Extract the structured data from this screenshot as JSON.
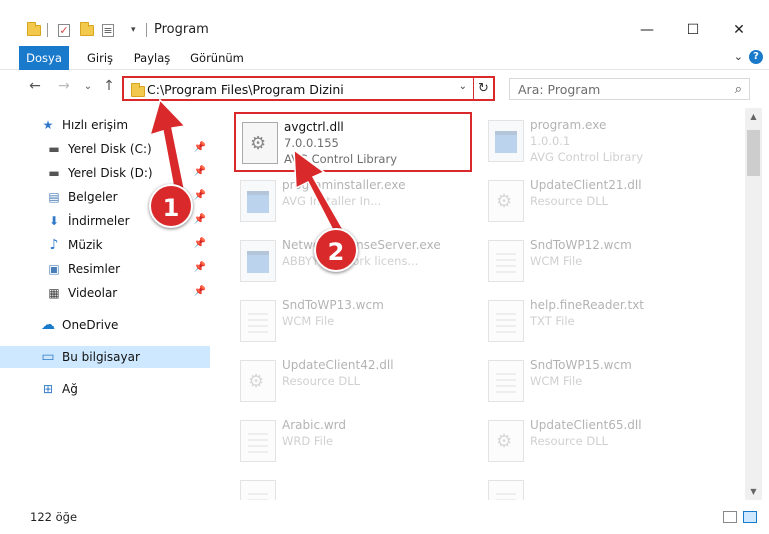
{
  "window": {
    "title": "Program",
    "minimize": "—",
    "maximize": "☐",
    "close": "✕"
  },
  "ribbon": {
    "tabs": [
      {
        "label": "Dosya"
      },
      {
        "label": "Giriş"
      },
      {
        "label": "Paylaş"
      },
      {
        "label": "Görünüm"
      }
    ],
    "expand": "⌄",
    "help": "?"
  },
  "nav": {
    "back": "←",
    "forward": "→",
    "recent": "⌄",
    "up": "↑",
    "address": "C:\\Program Files\\Program Dizini",
    "address_dropdown": "⌄",
    "refresh": "↻",
    "search_placeholder": "Ara: Program",
    "search_icon": "⌕"
  },
  "sidebar": {
    "items": [
      {
        "label": "Hızlı erişim",
        "icon": "star-icon",
        "glyph": "★",
        "color": "#2f79c8"
      },
      {
        "label": "Yerel Disk (C:)",
        "icon": "drive-icon",
        "glyph": "▬",
        "color": "#555555",
        "pin": "📌"
      },
      {
        "label": "Yerel Disk (D:)",
        "icon": "drive-icon",
        "glyph": "▬",
        "color": "#555555",
        "pin": "📌"
      },
      {
        "label": "Belgeler",
        "icon": "documents-icon",
        "glyph": "▤",
        "color": "#4a7ebb",
        "pin": "📌"
      },
      {
        "label": "İndirmeler",
        "icon": "download-icon",
        "glyph": "⬇",
        "color": "#2f79c8",
        "pin": "📌"
      },
      {
        "label": "Müzik",
        "icon": "music-icon",
        "glyph": "♪",
        "color": "#2f79c8",
        "pin": "📌"
      },
      {
        "label": "Resimler",
        "icon": "pictures-icon",
        "glyph": "▣",
        "color": "#4a7ebb",
        "pin": "📌"
      },
      {
        "label": "Videolar",
        "icon": "videos-icon",
        "glyph": "▦",
        "color": "#444444",
        "pin": "📌"
      },
      {
        "label": "OneDrive",
        "icon": "cloud-icon",
        "glyph": "☁",
        "color": "#1979ca"
      },
      {
        "label": "Bu bilgisayar",
        "icon": "computer-icon",
        "glyph": "▭",
        "color": "#2f79c8"
      },
      {
        "label": "Ağ",
        "icon": "network-icon",
        "glyph": "⊞",
        "color": "#2f79c8"
      }
    ]
  },
  "files": [
    {
      "name": "avgctrl.dll",
      "version": "7.0.0.155",
      "desc": "AVG Control Library",
      "type": "dll"
    },
    {
      "name": "program.exe",
      "version": "1.0.0.1",
      "desc": "AVG Control Library",
      "type": "exe"
    },
    {
      "name": "programinstaller.exe",
      "version": "",
      "desc": "AVG Installer In...",
      "type": "exe"
    },
    {
      "name": "UpdateClient21.dll",
      "version": "",
      "desc": "Resource DLL",
      "type": "dll"
    },
    {
      "name": "NetworkLicenseServer.exe",
      "version": "",
      "desc": "ABBYY Network licens...",
      "type": "exe"
    },
    {
      "name": "SndToWP12.wcm",
      "version": "",
      "desc": "WCM File",
      "type": "doc"
    },
    {
      "name": "SndToWP13.wcm",
      "version": "",
      "desc": "WCM File",
      "type": "doc"
    },
    {
      "name": "help.fineReader.txt",
      "version": "",
      "desc": "TXT File",
      "type": "doc"
    },
    {
      "name": "UpdateClient42.dll",
      "version": "",
      "desc": "Resource DLL",
      "type": "dll"
    },
    {
      "name": "SndToWP15.wcm",
      "version": "",
      "desc": "WCM File",
      "type": "doc"
    },
    {
      "name": "Arabic.wrd",
      "version": "",
      "desc": "WRD File",
      "type": "doc"
    },
    {
      "name": "UpdateClient65.dll",
      "version": "",
      "desc": "Resource DLL",
      "type": "dll"
    }
  ],
  "status": {
    "count": "122 öğe"
  },
  "annotations": {
    "step1": "1",
    "step2": "2",
    "accent": "#d9292a"
  }
}
